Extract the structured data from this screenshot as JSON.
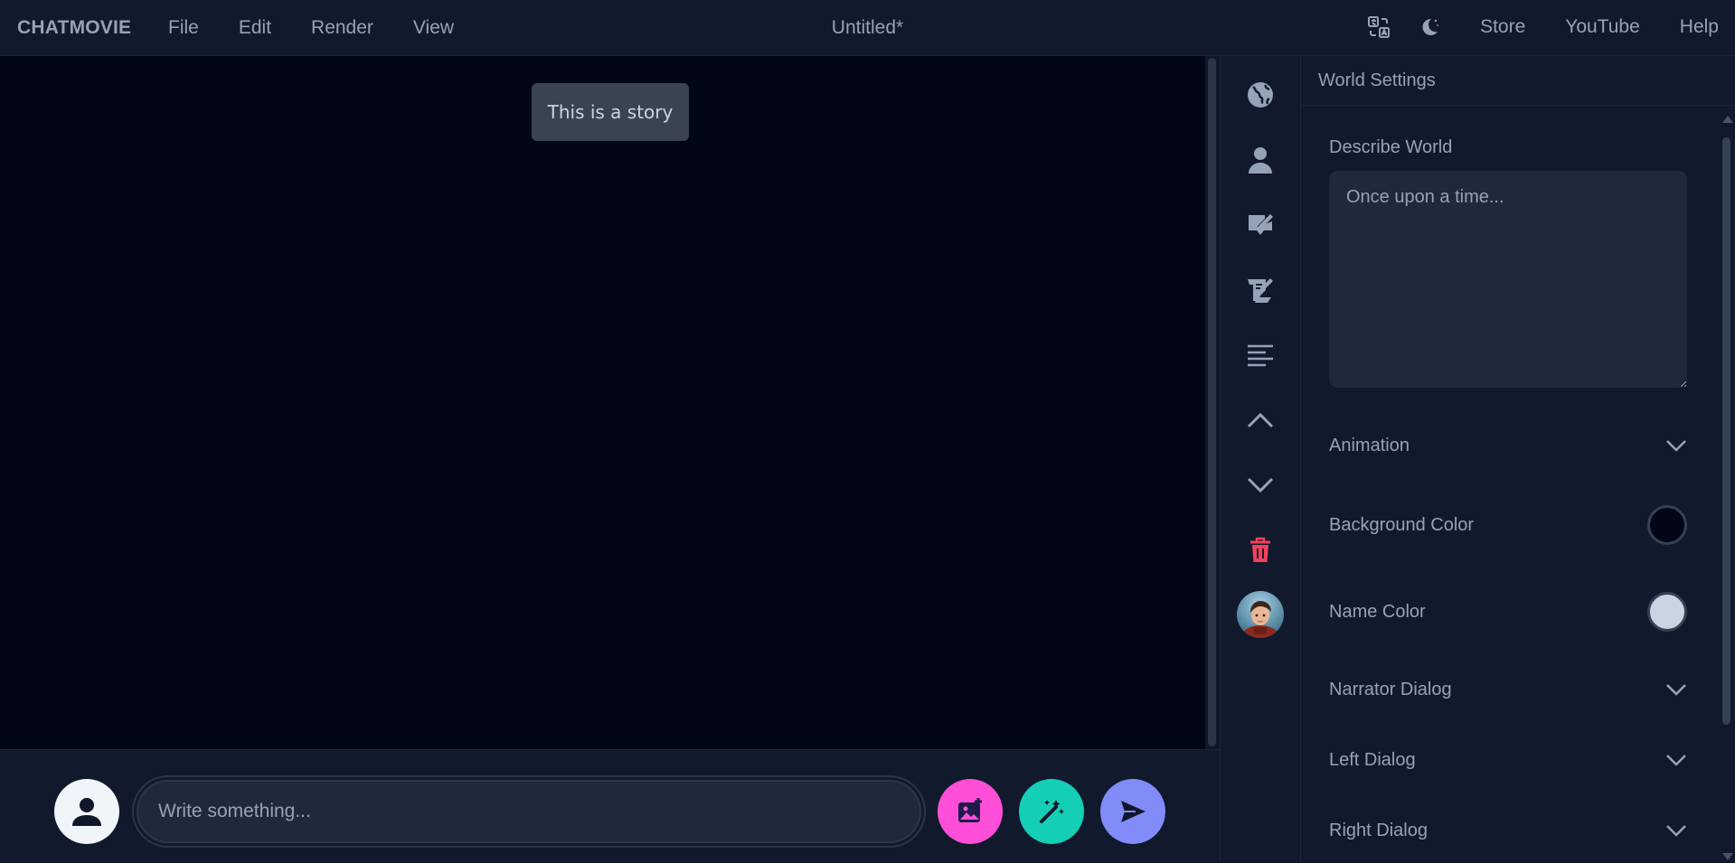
{
  "app": {
    "brand": "CHATMOVIE",
    "doc_title": "Untitled*"
  },
  "menu": {
    "items": [
      {
        "label": "File"
      },
      {
        "label": "Edit"
      },
      {
        "label": "Render"
      },
      {
        "label": "View"
      }
    ],
    "right": {
      "translate_icon": "translate-icon",
      "theme_icon": "moon-icon",
      "store": "Store",
      "youtube": "YouTube",
      "help": "Help"
    }
  },
  "canvas": {
    "story_text": "This is a story",
    "background": "#020617"
  },
  "composer": {
    "placeholder": "Write something...",
    "avatar_icon": "user-icon",
    "buttons": [
      {
        "icon": "add-image-icon",
        "color": "#ff4fd8"
      },
      {
        "icon": "magic-wand-icon",
        "color": "#14cfb5"
      },
      {
        "icon": "send-icon",
        "color": "#818cf8"
      }
    ]
  },
  "toolbar": {
    "items": [
      {
        "icon": "globe-icon"
      },
      {
        "icon": "user-icon"
      },
      {
        "icon": "edit-note-icon"
      },
      {
        "icon": "script-icon"
      },
      {
        "icon": "align-left-icon"
      },
      {
        "icon": "chevron-up-icon"
      },
      {
        "icon": "chevron-down-icon"
      },
      {
        "icon": "trash-icon",
        "color": "#f43f5e"
      }
    ],
    "avatar_icon": "character-avatar"
  },
  "panel": {
    "title": "World Settings",
    "describe_label": "Describe World",
    "describe_placeholder": "Once upon a time...",
    "animation": "Animation",
    "background_color_label": "Background Color",
    "background_color": "#020617",
    "name_color_label": "Name Color",
    "name_color": "#cbd5e1",
    "narrator_dialog": "Narrator Dialog",
    "left_dialog": "Left Dialog",
    "right_dialog": "Right Dialog"
  }
}
